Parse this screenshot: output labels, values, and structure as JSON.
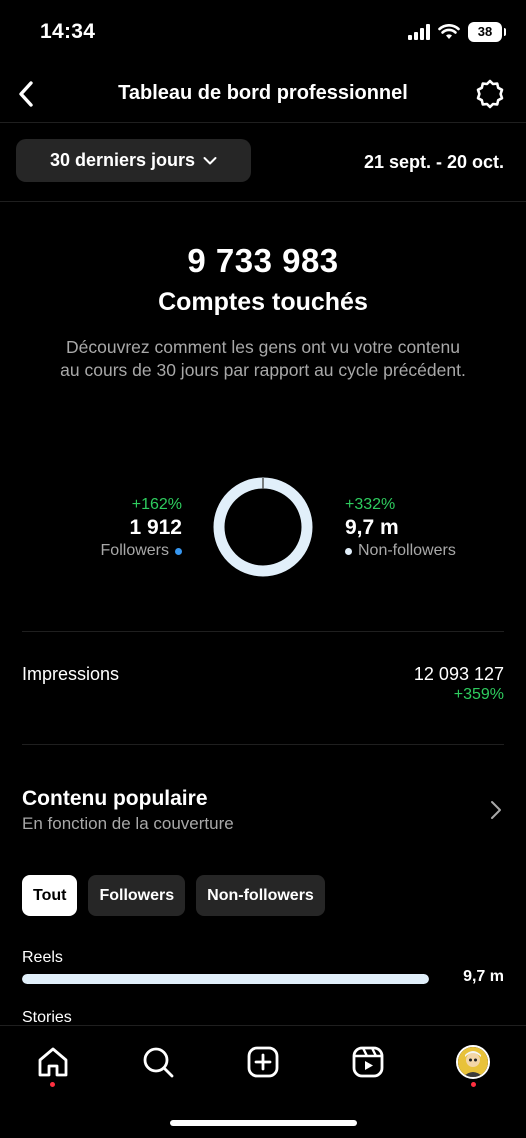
{
  "status_bar": {
    "time": "14:34",
    "battery": "38",
    "icons": [
      "signal-icon",
      "wifi-icon",
      "battery-icon"
    ]
  },
  "header": {
    "title": "Tableau de bord professionnel",
    "back_icon": "chevron-left-icon",
    "settings_icon": "gear-icon"
  },
  "range": {
    "selector_label": "30 derniers jours",
    "dates": "21 sept. - 20 oct."
  },
  "reach": {
    "value": "9 733 983",
    "label": "Comptes touchés",
    "description": "Découvrez comment les gens ont vu votre contenu au cours de 30 jours par rapport au cycle précédent.",
    "followers": {
      "change": "+162%",
      "value": "1 912",
      "label": "Followers",
      "color": "#3797f0"
    },
    "non_followers": {
      "change": "+332%",
      "value": "9,7 m",
      "label": "Non-followers",
      "color": "#e1effa"
    },
    "donut": {
      "followers_share": 0.0002,
      "non_followers_share": 0.9998
    }
  },
  "impressions": {
    "label": "Impressions",
    "value": "12 093 127",
    "change": "+359%"
  },
  "popular": {
    "title": "Contenu populaire",
    "subtitle": "En fonction de la couverture",
    "chips": [
      {
        "label": "Tout",
        "active": true
      },
      {
        "label": "Followers",
        "active": false
      },
      {
        "label": "Non-followers",
        "active": false
      }
    ],
    "reels": {
      "label": "Reels",
      "value": "9,7 m",
      "fill_fraction": 1.0
    },
    "stories_label": "Stories"
  },
  "bottom_nav": {
    "items": [
      "home-icon",
      "search-icon",
      "create-icon",
      "reels-icon",
      "profile-avatar"
    ]
  },
  "colors": {
    "positive": "#2ecc5e",
    "muted": "#a8a8a8",
    "chip_bg": "#262626",
    "notification_dot": "#ff3040"
  }
}
